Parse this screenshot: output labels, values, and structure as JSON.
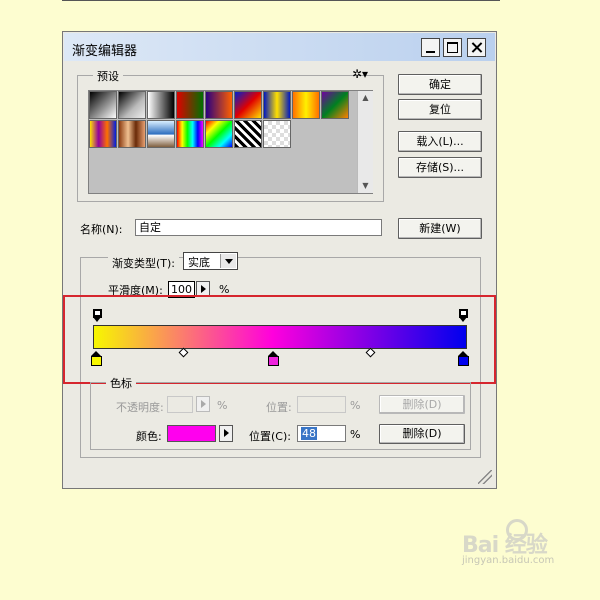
{
  "dialog": {
    "title": "渐变编辑器"
  },
  "presets": {
    "label": "预设",
    "swatches": [
      {
        "name": "black-white-swatch",
        "bg": "linear-gradient(135deg,#000 0%,#fff 100%)"
      },
      {
        "name": "fg-transparent-swatch",
        "bg": "linear-gradient(135deg,#000 0%,#bbb 60%,#eee 100%)"
      },
      {
        "name": "black-fade-swatch",
        "bg": "linear-gradient(90deg,#fff 0%,#000 100%)"
      },
      {
        "name": "red-green-swatch",
        "bg": "linear-gradient(90deg,#e00000 0%,#007000 100%)"
      },
      {
        "name": "violet-orange-swatch",
        "bg": "linear-gradient(90deg,#2a0080 0%,#ff6000 100%)"
      },
      {
        "name": "blue-red-yellow-swatch",
        "bg": "linear-gradient(135deg,#0020d0 0%,#e00000 50%,#ffe000 100%)"
      },
      {
        "name": "blue-yellow-blue-swatch",
        "bg": "linear-gradient(90deg,#0018c0 0%,#ffe000 50%,#0018c0 100%)"
      },
      {
        "name": "orange-yellow-orange-swatch",
        "bg": "linear-gradient(90deg,#ff7000 0%,#fff000 50%,#ff7000 100%)"
      },
      {
        "name": "violet-green-orange-swatch",
        "bg": "linear-gradient(135deg,#7000a0 0%,#008020 50%,#ff8000 100%)"
      },
      {
        "name": "yellow-violet-orange-blue-swatch",
        "bg": "linear-gradient(90deg,#ffe000 0%,#9000a0 33%,#ff7000 66%,#0020e0 100%)"
      },
      {
        "name": "copper-swatch",
        "bg": "linear-gradient(90deg,#8a3a10 0%,#f0c090 35%,#6a2a08 65%,#e8a070 100%)"
      },
      {
        "name": "chrome-swatch",
        "bg": "linear-gradient(180deg,#d8eeff 0%,#3070c0 50%,#fff 55%,#806040 100%)"
      },
      {
        "name": "spectrum-swatch",
        "bg": "linear-gradient(90deg,#f00,#ff0,#0f0,#0ff,#00f,#f0f)"
      },
      {
        "name": "transparent-rainbow-swatch",
        "bg": "linear-gradient(135deg,#f00,#ff0,#0f0,#0ff,#00f)"
      },
      {
        "name": "transparent-stripes-swatch",
        "bg": "repeating-linear-gradient(45deg,#000 0 3px,#fff 3px 6px)"
      },
      {
        "name": "checker-swatch",
        "bg": "repeating-conic-gradient(#ddd 0 25%,#fff 0 50%) 0 0/8px 8px"
      }
    ]
  },
  "buttons": {
    "ok": "确定",
    "reset": "复位",
    "load": "载入(L)...",
    "save": "存储(S)...",
    "new": "新建(W)",
    "delete_opacity": "删除(D)",
    "delete_color": "删除(D)"
  },
  "name_field": {
    "label": "名称(N):",
    "value": "自定"
  },
  "gradient": {
    "type_label": "渐变类型(T):",
    "type_value": "实底",
    "smoothness_label": "平滑度(M):",
    "smoothness_value": "100",
    "smoothness_unit": "%",
    "color_stops": [
      {
        "name": "color-stop-yellow",
        "color": "#f7f700",
        "location": 0
      },
      {
        "name": "color-stop-magenta",
        "color": "#ee22dd",
        "location": 48
      },
      {
        "name": "color-stop-blue",
        "color": "#0000ee",
        "location": 100
      }
    ],
    "opacity_stops": [
      {
        "name": "opacity-stop-start",
        "location": 0
      },
      {
        "name": "opacity-stop-end",
        "location": 100
      }
    ],
    "midpoints": [
      24,
      74
    ]
  },
  "stops_panel": {
    "label": "色标",
    "opacity_label": "不透明度:",
    "opacity_unit": "%",
    "opacity_location_label": "位置:",
    "opacity_location_unit": "%",
    "color_label": "颜色:",
    "color_value": "#ff00ee",
    "location_label": "位置(C):",
    "location_value": "48",
    "location_unit": "%"
  },
  "watermark": {
    "main": "Bai 经验",
    "sub": "jingyan.baidu.com"
  }
}
